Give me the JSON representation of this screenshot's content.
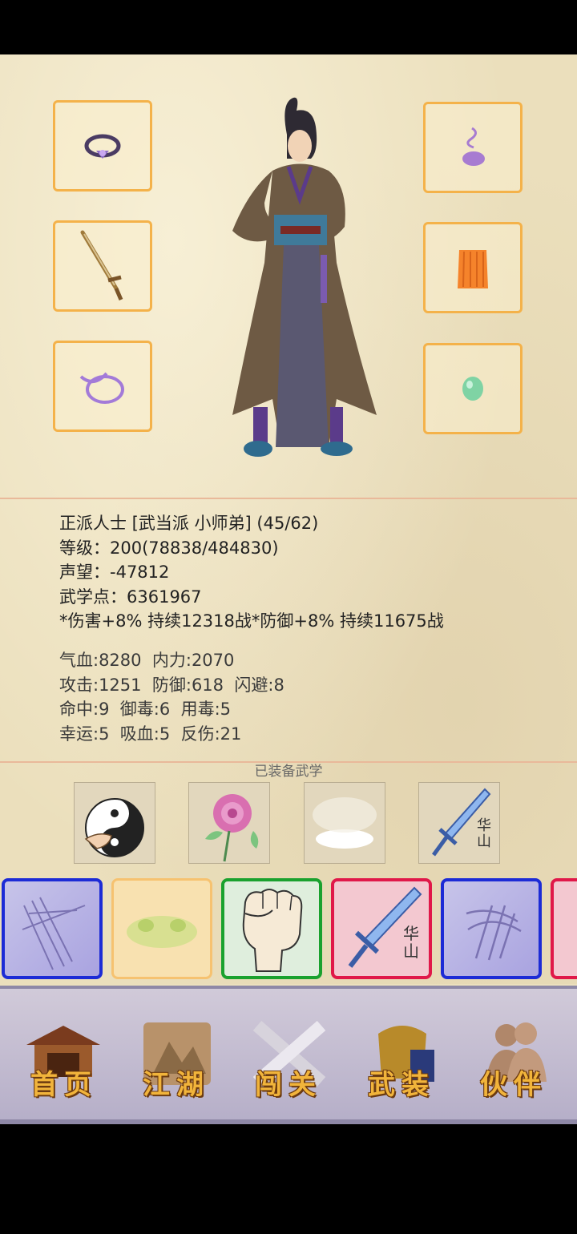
{
  "character": {
    "title_line": "正派人士 [武当派 小师弟] (45/62)",
    "level": "等级：200(78838/484830)",
    "reputation": "声望：-47812",
    "martial_points": "武学点：6361967",
    "buffs": "*伤害+8% 持续12318战*防御+8% 持续11675战"
  },
  "stats": {
    "row1": "气血:8280  内力:2070",
    "row2": "攻击:1251  防御:618  闪避:8",
    "row3": "命中:9  御毒:6  用毒:5",
    "row4": "幸运:5  吸血:5  反伤:21"
  },
  "equipped_skills_label": "已装备武学",
  "skill_card_text": "华山",
  "cards": [
    {
      "name": "slash",
      "color": "blue"
    },
    {
      "name": "toad",
      "color": "orange"
    },
    {
      "name": "fist",
      "color": "green"
    },
    {
      "name": "sword",
      "color": "red",
      "text": "华山"
    },
    {
      "name": "scratch",
      "color": "blue"
    },
    {
      "name": "partial",
      "color": "red"
    }
  ],
  "nav": {
    "home": "首页",
    "jianghu": "江湖",
    "challenge": "闯关",
    "gear": "武装",
    "partner": "伙伴"
  }
}
